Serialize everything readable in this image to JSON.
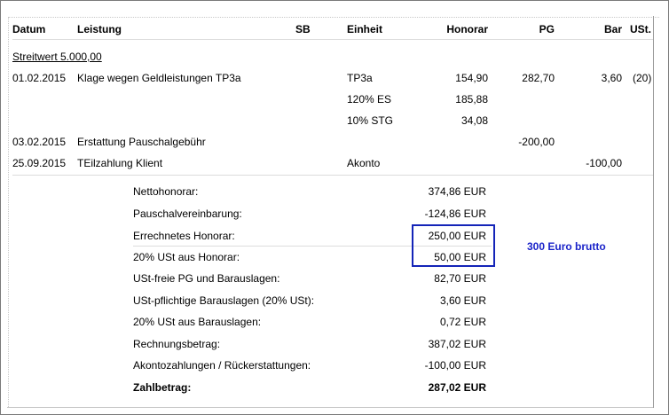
{
  "table": {
    "headers": {
      "datum": "Datum",
      "leistung": "Leistung",
      "sb": "SB",
      "einheit": "Einheit",
      "honorar": "Honorar",
      "pg": "PG",
      "bar": "Bar",
      "ust": "USt."
    },
    "streitwert": "Streitwert 5.000,00",
    "rows": [
      {
        "datum": "01.02.2015",
        "leistung": "Klage wegen Geldleistungen TP3a",
        "einheit": "TP3a",
        "honorar": "154,90",
        "pg": "282,70",
        "bar": "3,60",
        "ust": "(20)"
      },
      {
        "datum": "",
        "leistung": "",
        "einheit": "120% ES",
        "honorar": "185,88",
        "pg": "",
        "bar": "",
        "ust": ""
      },
      {
        "datum": "",
        "leistung": "",
        "einheit": "10% STG",
        "honorar": "34,08",
        "pg": "",
        "bar": "",
        "ust": ""
      },
      {
        "datum": "03.02.2015",
        "leistung": "Erstattung Pauschalgebühr",
        "einheit": "",
        "honorar": "",
        "pg": "-200,00",
        "bar": "",
        "ust": ""
      },
      {
        "datum": "25.09.2015",
        "leistung": "TEilzahlung Klient",
        "einheit": "Akonto",
        "honorar": "",
        "pg": "",
        "bar": "-100,00",
        "ust": ""
      }
    ]
  },
  "summary": [
    {
      "label": "Nettohonorar:",
      "value": "374,86 EUR"
    },
    {
      "label": "Pauschalvereinbarung:",
      "value": "-124,86 EUR"
    },
    {
      "label": "Errechnetes Honorar:",
      "value": "250,00 EUR"
    },
    {
      "label": "20% USt aus Honorar:",
      "value": "50,00 EUR"
    },
    {
      "label": "USt-freie PG und Barauslagen:",
      "value": "82,70 EUR"
    },
    {
      "label": "USt-pflichtige Barauslagen (20% USt):",
      "value": "3,60 EUR"
    },
    {
      "label": "20% USt aus Barauslagen:",
      "value": "0,72 EUR"
    },
    {
      "label": "Rechnungsbetrag:",
      "value": "387,02 EUR"
    },
    {
      "label": "Akontozahlungen / Rückerstattungen:",
      "value": "-100,00 EUR"
    },
    {
      "label": "Zahlbetrag:",
      "value": "287,02 EUR"
    }
  ],
  "annotation": {
    "text": "300 Euro brutto",
    "color": "#1a23c9"
  }
}
